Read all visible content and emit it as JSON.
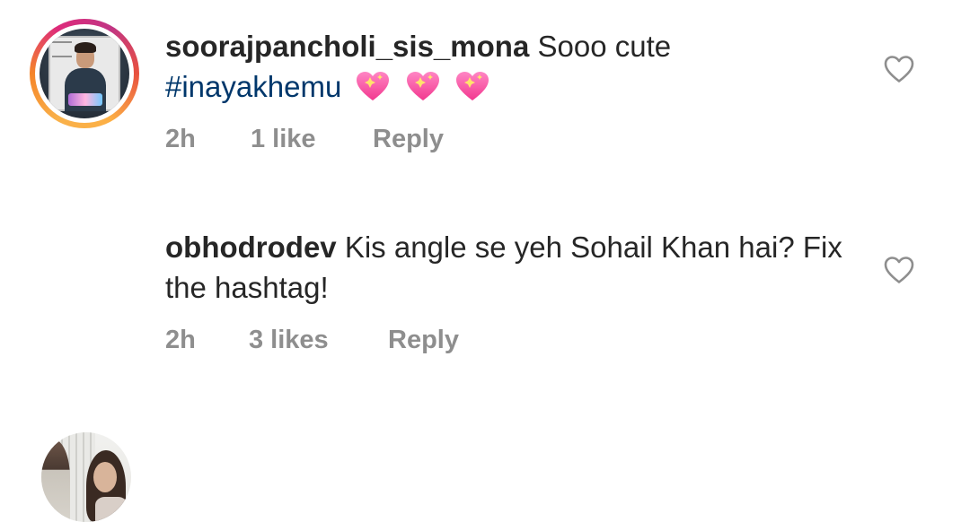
{
  "comments": [
    {
      "username": "soorajpancholi_sis_mona",
      "text": "Sooo cute",
      "hashtag": "#inayakhemu",
      "emoji": "sparkling-heart",
      "time": "2h",
      "likes": "1 like",
      "reply": "Reply",
      "has_story_ring": true
    },
    {
      "username": "obhodrodev",
      "text": "Kis angle se yeh Sohail Khan hai? Fix the hashtag!",
      "time": "2h",
      "likes": "3 likes",
      "reply": "Reply",
      "has_story_ring": false
    }
  ],
  "icons": {
    "like": "heart-outline-icon"
  },
  "colors": {
    "text": "#262626",
    "secondary": "#8e8e8e",
    "hashtag": "#00376b",
    "emoji_heart": "#ff4fa3"
  }
}
